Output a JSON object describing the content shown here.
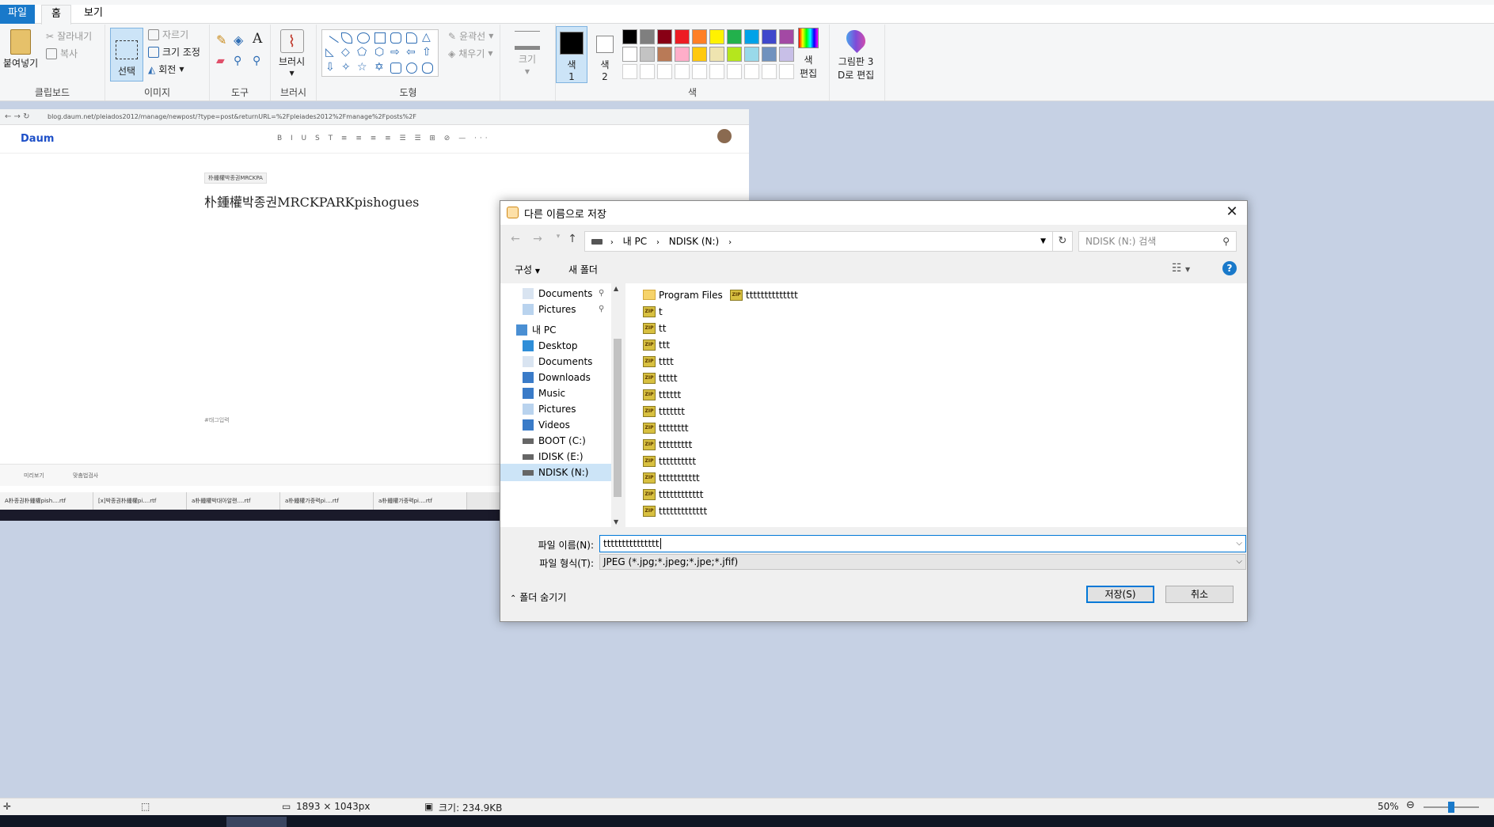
{
  "ribbon": {
    "tabs": {
      "file": "파일",
      "home": "홈",
      "view": "보기"
    },
    "clipboard": {
      "paste": "붙여넣기",
      "cut": "잘라내기",
      "copy": "복사",
      "label": "클립보드"
    },
    "image": {
      "select": "선택",
      "crop": "자르기",
      "resize": "크기 조정",
      "rotate": "회전",
      "label": "이미지"
    },
    "tools": {
      "label": "도구"
    },
    "brushes": {
      "label": "브러시"
    },
    "shapes": {
      "outline": "윤곽선",
      "fill": "채우기",
      "label": "도형"
    },
    "size": {
      "label": "크기"
    },
    "colors": {
      "color1_line1": "색",
      "color1_line2": "1",
      "color2_line1": "색",
      "color2_line2": "2",
      "edit_line1": "색",
      "edit_line2": "편집",
      "label": "색",
      "color1": "#000000",
      "color2": "#ffffff",
      "palette_row1": [
        "#000000",
        "#7f7f7f",
        "#880015",
        "#ed1c24",
        "#ff7f27",
        "#fff200",
        "#22b14c",
        "#00a2e8",
        "#3f48cc",
        "#a349a4"
      ],
      "palette_row2": [
        "#ffffff",
        "#c3c3c3",
        "#b97a57",
        "#ffaec9",
        "#ffc90e",
        "#efe4b0",
        "#b5e61d",
        "#99d9ea",
        "#7092be",
        "#c8bfe7"
      ]
    },
    "paint3d": {
      "line1": "그림판 3",
      "line2": "D로 편집"
    }
  },
  "browser": {
    "url": "blog.daum.net/pleiados2012/manage/newpost/?type=post&returnURL=%2Fpleiades2012%2Fmanage%2Fposts%2F",
    "logo": "Daum",
    "chip": "朴鍾權박종권MRCKPA",
    "title": "朴鍾權박종권MRCKPARKpishogues",
    "tags_hint": "#태그입력",
    "footer_preview": "미리보기",
    "footer_spell": "맞춤법검사",
    "doc_tabs": [
      "A朴종권朴鍾權pish....rtf",
      "[x]박종권朴鍾權pi....rtf",
      "a朴鍾權박대아알랜....rtf",
      "a朴鍾權가중력pi....rtf",
      "a朴鍾權가중력pi....rtf"
    ]
  },
  "dialog": {
    "title": "다른 이름으로 저장",
    "path": [
      "내 PC",
      "NDISK (N:)"
    ],
    "search_placeholder": "NDISK (N:) 검색",
    "organize": "구성",
    "new_folder": "새 폴더",
    "help": "?",
    "nav": [
      "Documents",
      "Pictures",
      "내 PC",
      "Desktop",
      "Documents",
      "Downloads",
      "Music",
      "Pictures",
      "Videos",
      "BOOT (C:)",
      "IDISK (E:)",
      "NDISK (N:)"
    ],
    "files_col1": [
      "Program Files",
      "t",
      "tt",
      "ttt",
      "tttt",
      "ttttt",
      "tttttt",
      "ttttttt",
      "tttttttt",
      "ttttttttt",
      "tttttttttt",
      "ttttttttttt",
      "tttttttttttt",
      "ttttttttttttt"
    ],
    "files_col2": [
      "tttttttttttttt"
    ],
    "filename_label": "파일 이름(N):",
    "filename_value": "ttttttttttttttt",
    "filetype_label": "파일 형식(T):",
    "filetype_value": "JPEG (*.jpg;*.jpeg;*.jpe;*.jfif)",
    "hide_folders": "폴더 숨기기",
    "save": "저장(S)",
    "cancel": "취소"
  },
  "statusbar": {
    "dimensions": "1893 × 1043px",
    "filesize": "크기: 234.9KB",
    "zoom": "50%",
    "zoom_level": 0.5
  }
}
